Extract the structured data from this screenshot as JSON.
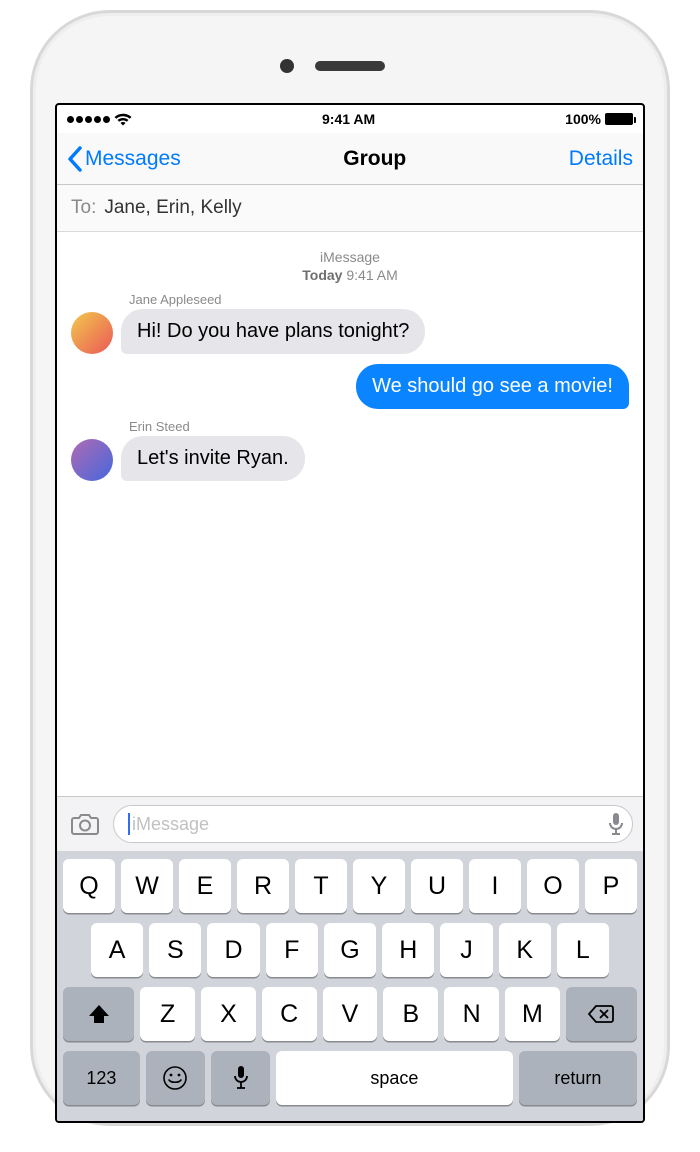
{
  "status_bar": {
    "time": "9:41 AM",
    "battery_pct": "100%"
  },
  "nav": {
    "back_label": "Messages",
    "title": "Group",
    "details_label": "Details"
  },
  "to_field": {
    "label": "To:",
    "recipients": "Jane, Erin, Kelly"
  },
  "thread": {
    "service_label": "iMessage",
    "timestamp_day": "Today",
    "timestamp_time": "9:41 AM",
    "messages": [
      {
        "sender": "Jane Appleseed",
        "text": "Hi! Do you have plans tonight?",
        "outgoing": false
      },
      {
        "sender": "",
        "text": "We should go see a movie!",
        "outgoing": true
      },
      {
        "sender": "Erin Steed",
        "text": "Let's invite Ryan.",
        "outgoing": false
      }
    ]
  },
  "composer": {
    "placeholder": "iMessage"
  },
  "keyboard": {
    "row1": [
      "Q",
      "W",
      "E",
      "R",
      "T",
      "Y",
      "U",
      "I",
      "O",
      "P"
    ],
    "row2": [
      "A",
      "S",
      "D",
      "F",
      "G",
      "H",
      "J",
      "K",
      "L"
    ],
    "row3": [
      "Z",
      "X",
      "C",
      "V",
      "B",
      "N",
      "M"
    ],
    "num_label": "123",
    "space_label": "space",
    "return_label": "return"
  }
}
